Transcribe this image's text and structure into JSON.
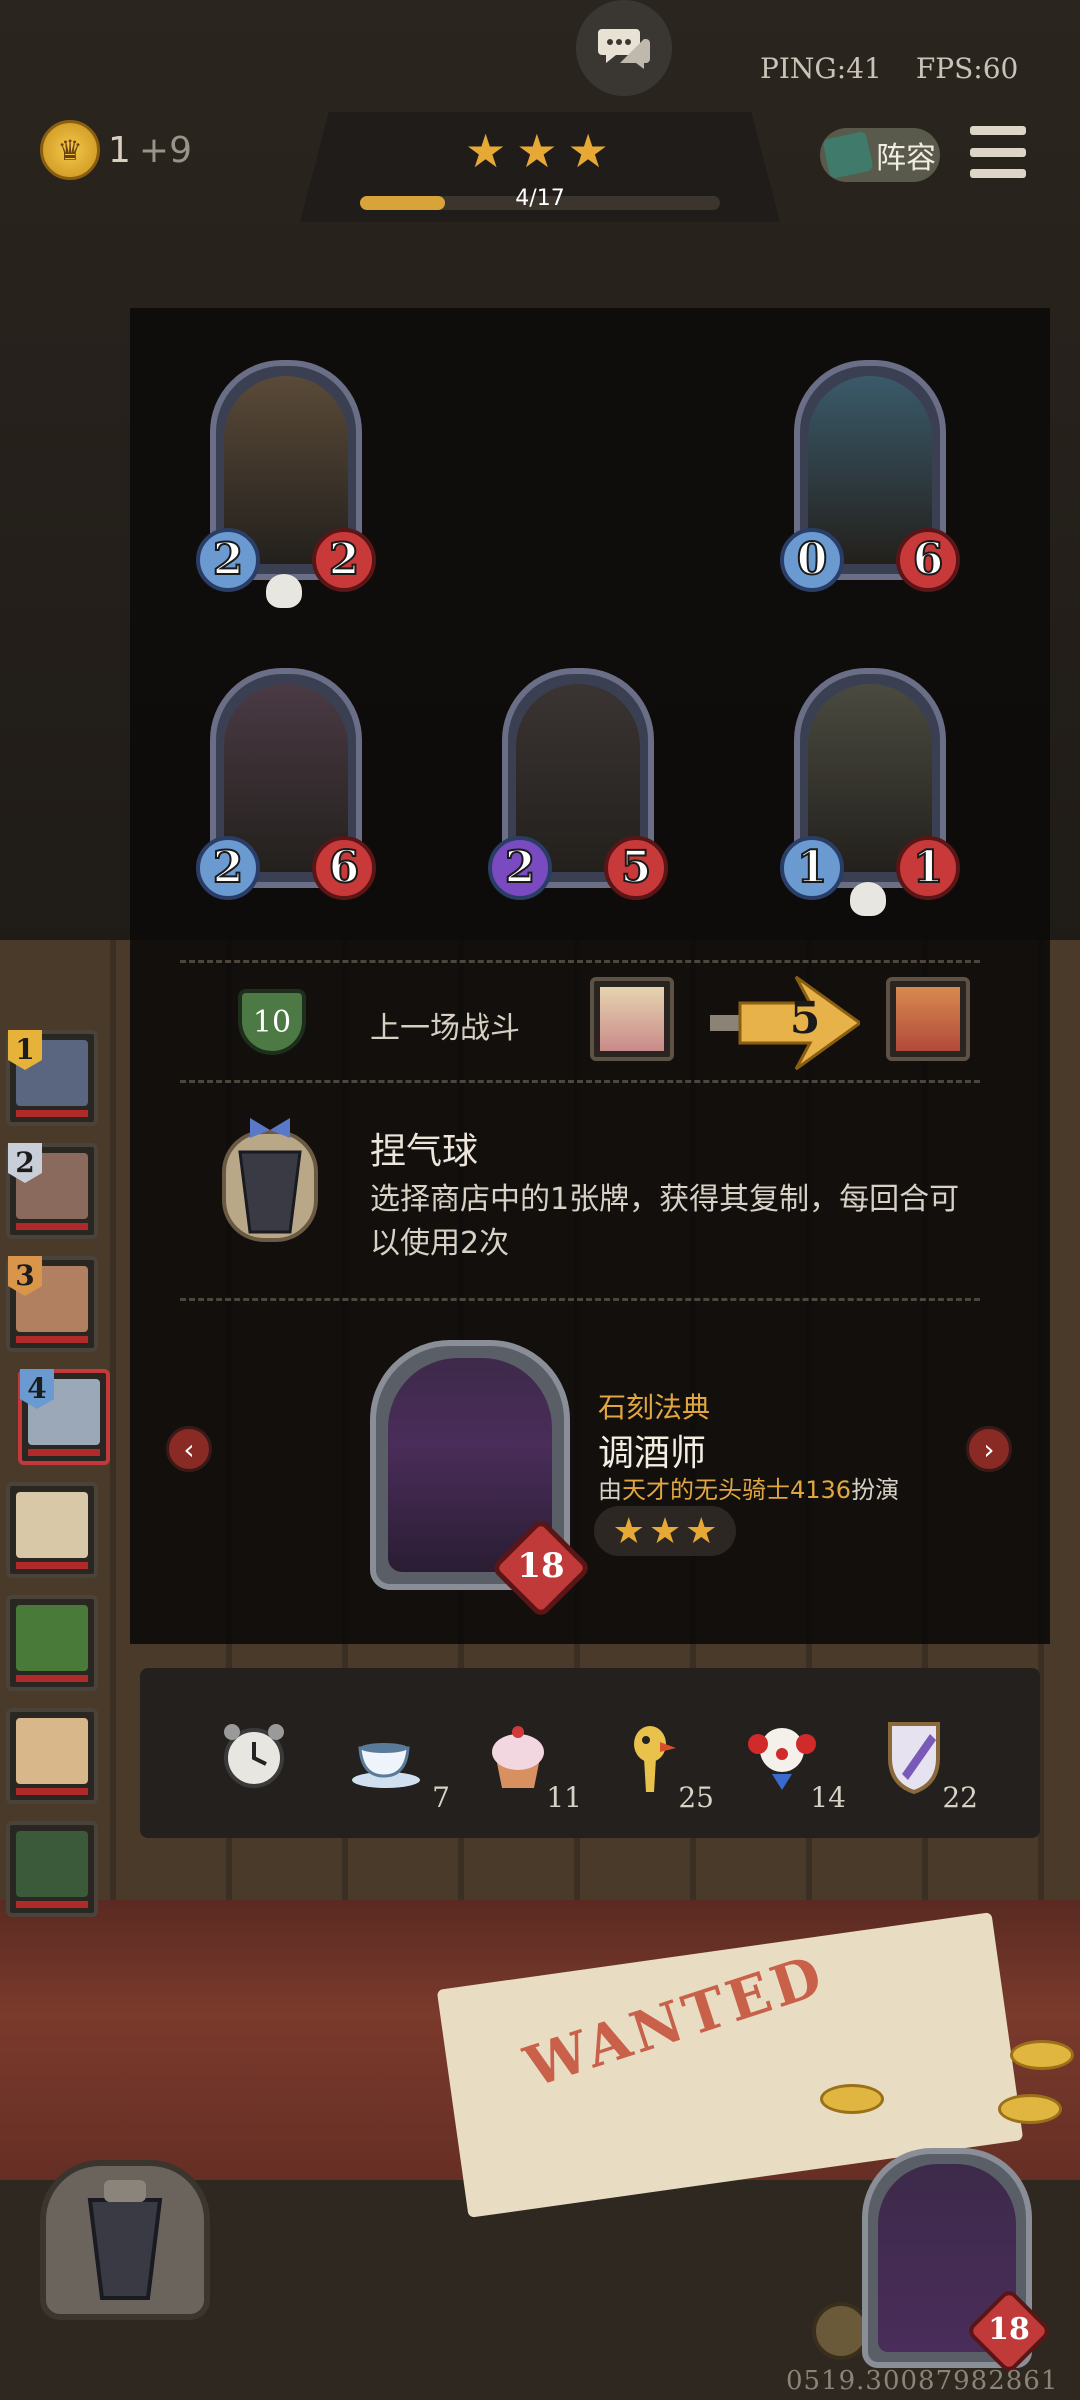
{
  "header": {
    "ping_label": "PING:41",
    "fps_label": "FPS:60",
    "gold": "1",
    "gold_bonus": "+9",
    "lineup_label": "阵容",
    "progress_text": "4/17",
    "progress_fraction": 0.235,
    "star_count": 3
  },
  "sidebar": {
    "players": [
      {
        "rank": "1",
        "color": "#e7b23a",
        "face": "#5a6680"
      },
      {
        "rank": "2",
        "color": "#c9cfd8",
        "face": "#8a6a5c"
      },
      {
        "rank": "3",
        "color": "#d9964a",
        "face": "#b08060"
      },
      {
        "rank": "4",
        "color": "#6a9ad0",
        "face": "#9aa8b8"
      },
      {
        "rank": "",
        "color": "",
        "face": "#d8c8a8"
      },
      {
        "rank": "",
        "color": "",
        "face": "#4a7a3a"
      },
      {
        "rank": "",
        "color": "",
        "face": "#d8b88a"
      },
      {
        "rank": "",
        "color": "",
        "face": "#3a5a3a"
      }
    ]
  },
  "board": {
    "cards": [
      {
        "attack": "2",
        "health": "2",
        "skull": true,
        "art": "#5a4a38",
        "atk_color": "#6a9ad0"
      },
      {
        "attack": "0",
        "health": "6",
        "skull": false,
        "art": "#3a5a6a",
        "atk_color": "#6a9ad0"
      },
      {
        "attack": "2",
        "health": "6",
        "skull": false,
        "art": "#4a3a44",
        "atk_color": "#6a9ad0"
      },
      {
        "attack": "2",
        "health": "5",
        "skull": false,
        "art": "#3a3432",
        "atk_color": "#7a4ac0"
      },
      {
        "attack": "1",
        "health": "1",
        "skull": true,
        "art": "#4a4a40",
        "atk_color": "#6a9ad0"
      }
    ]
  },
  "battle": {
    "tier": "10",
    "label": "上一场战斗",
    "damage": "5"
  },
  "hero_power": {
    "name": "捏气球",
    "description": "选择商店中的1张牌，获得其复制，每回合可以使用2次"
  },
  "hero": {
    "set": "石刻法典",
    "name": "调酒师",
    "credit_prefix": "由",
    "credit_name": "天才的无头骑士4136",
    "credit_suffix": "扮演",
    "health": "18",
    "stars": 3
  },
  "stats": [
    {
      "icon": "alarm-clock-icon",
      "count": ""
    },
    {
      "icon": "teacup-icon",
      "count": "7"
    },
    {
      "icon": "cupcake-icon",
      "count": "11"
    },
    {
      "icon": "rubber-chicken-icon",
      "count": "25"
    },
    {
      "icon": "clown-icon",
      "count": "14"
    },
    {
      "icon": "shield-crest-icon",
      "count": "22"
    }
  ],
  "table": {
    "wanted_text": "WANTED"
  },
  "player": {
    "health": "18",
    "build_id": "0519.30087982861"
  },
  "colors": {
    "star": "#e7a936",
    "accent_red": "#c13a3a",
    "highlight_gold": "#e0a640"
  }
}
